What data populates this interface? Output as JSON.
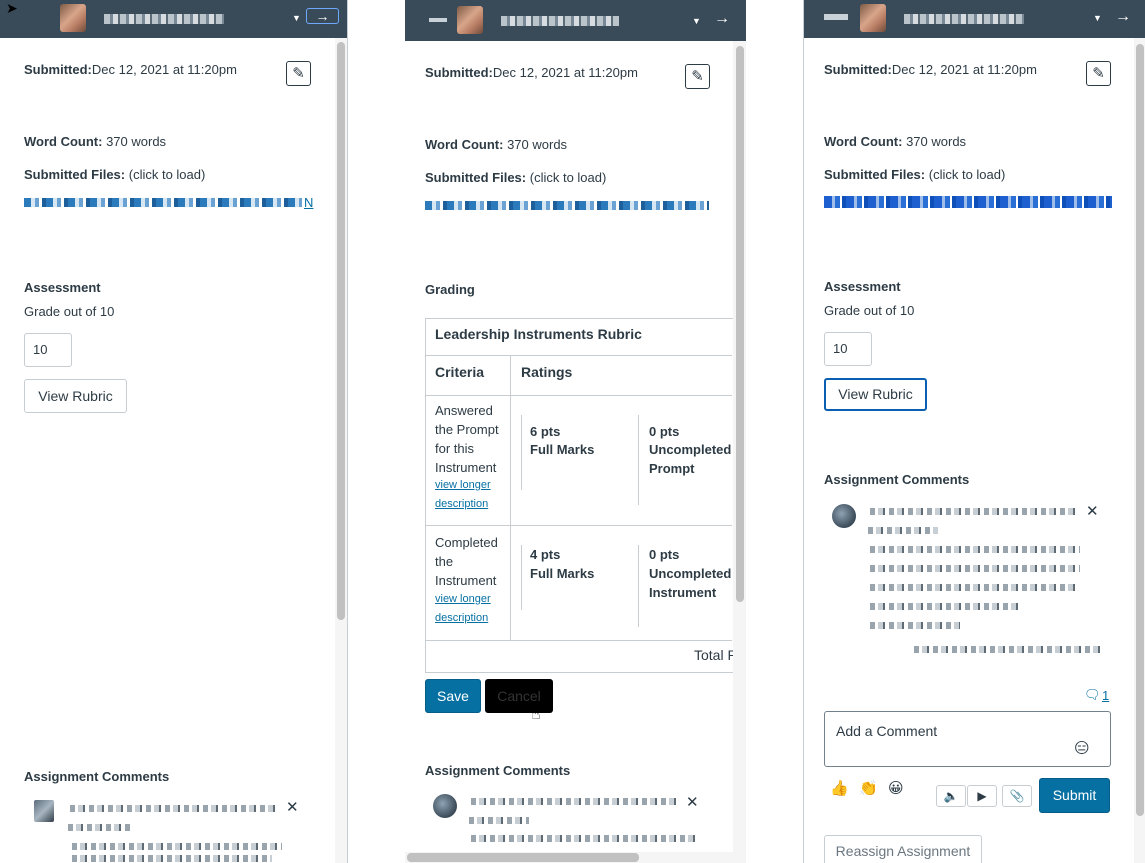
{
  "panel1": {
    "submitted_label": "Submitted:",
    "submitted_value": "Dec 12, 2021 at 11:20pm",
    "word_count_label": "Word Count:",
    "word_count_value": " 370 words",
    "submitted_files_label": "Submitted Files:",
    "submitted_files_hint": " (click to load)",
    "file_suffix": "N",
    "assessment_label": "Assessment",
    "grade_out_of": "Grade out of 10",
    "grade_value": "10",
    "view_rubric_label": "View Rubric",
    "comments_label": "Assignment Comments",
    "close_glyph": "✕"
  },
  "panel2": {
    "submitted_label": "Submitted:",
    "submitted_value": "Dec 12, 2021 at 11:20pm",
    "word_count_label": "Word Count:",
    "word_count_value": " 370 words",
    "submitted_files_label": "Submitted Files:",
    "submitted_files_hint": " (click to load)",
    "grading_label": "Grading",
    "rubric": {
      "title": "Leadership Instruments Rubric",
      "criteria_header": "Criteria",
      "ratings_header": "Ratings",
      "rows": [
        {
          "criterion": "Answered the Prompt for this Instrument",
          "link": "view longer description",
          "ratings": [
            {
              "pts": "6 pts",
              "desc": "Full Marks"
            },
            {
              "pts": "0 pts",
              "desc": "Uncompleted Prompt"
            }
          ]
        },
        {
          "criterion": "Completed the Instrument",
          "link": "view longer description",
          "ratings": [
            {
              "pts": "4 pts",
              "desc": "Full Marks"
            },
            {
              "pts": "0 pts",
              "desc": "Uncompleted Instrument"
            }
          ]
        }
      ],
      "total_label": "Total P"
    },
    "save_label": "Save",
    "cancel_label": "Cancel",
    "comments_label": "Assignment Comments",
    "close_glyph": "✕"
  },
  "panel3": {
    "submitted_label": "Submitted:",
    "submitted_value": "Dec 12, 2021 at 11:20pm",
    "word_count_label": "Word Count:",
    "word_count_value": " 370 words",
    "submitted_files_label": "Submitted Files:",
    "submitted_files_hint": " (click to load)",
    "assessment_label": "Assessment",
    "grade_out_of": "Grade out of 10",
    "grade_value": "10",
    "view_rubric_label": "View Rubric",
    "comments_label": "Assignment Comments",
    "close_glyph": "✕",
    "comment_count": "1",
    "comment_placeholder": "Add a Comment",
    "quick_emojis": [
      "👍",
      "👏",
      "😀"
    ],
    "submit_label": "Submit",
    "reassign_label": "Reassign Assignment"
  },
  "icons": {
    "pencil": "✎",
    "arrow": "→",
    "caret": "▼"
  },
  "colors": {
    "topbar": "#394b58",
    "primary": "#0770a3",
    "link": "#0770a3"
  }
}
